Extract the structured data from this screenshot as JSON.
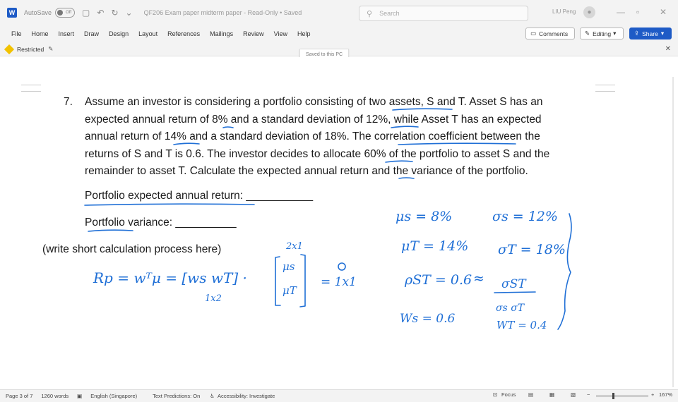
{
  "titlebar": {
    "autosave_label": "AutoSave",
    "autosave_state": "Off",
    "doc_title": "QF206 Exam paper midterm paper  -  Read-Only  •  Saved",
    "search_placeholder": "Search",
    "user_name": "LIU Peng"
  },
  "ribbon": {
    "tabs": [
      "File",
      "Home",
      "Insert",
      "Draw",
      "Design",
      "Layout",
      "References",
      "Mailings",
      "Review",
      "View",
      "Help"
    ],
    "comments_label": "Comments",
    "editing_label": "Editing",
    "share_label": "Share"
  },
  "restricted": {
    "label": "Restricted",
    "tooltip": "Saved to this PC"
  },
  "document": {
    "question_number": "7.",
    "question_lines": [
      "Assume an investor is considering a portfolio consisting of two assets, S and T. Asset S has an",
      "expected annual return of 8% and a standard deviation of 12%, while Asset T has an expected",
      "annual return of 14% and a standard deviation of 18%. The correlation coefficient between the",
      "returns of S and T is 0.6. The investor decides to allocate 60% of the portfolio to asset S and the",
      "remainder to asset T. Calculate the expected annual return and the variance of the portfolio."
    ],
    "answer_return": "Portfolio expected annual return: ___________",
    "answer_variance": "Portfolio variance: __________",
    "process_note": "(write short calculation process here)"
  },
  "handwriting": {
    "mu_s": "μs = 8%",
    "sigma_s": "σs = 12%",
    "mu_t": "μT = 14%",
    "sigma_t": "σT = 18%",
    "rho_st": "ρST = 0.6",
    "cov_num": "σST",
    "cov_den": "σs σT",
    "w_s": "Ws = 0.6",
    "w_t": "WT = 0.4",
    "rp_eq": "Rp =  wᵀμ  = [ws  wT] ·",
    "dim_mu": "2x1",
    "dim_w": "1x2",
    "vec_top": "μs",
    "vec_bottom": "μT",
    "result": "= 1x1"
  },
  "status": {
    "page": "Page 3 of 7",
    "words": "1260 words",
    "language": "English (Singapore)",
    "text_predictions": "Text Predictions: On",
    "accessibility": "Accessibility: Investigate",
    "focus": "Focus",
    "zoom": "167%"
  }
}
